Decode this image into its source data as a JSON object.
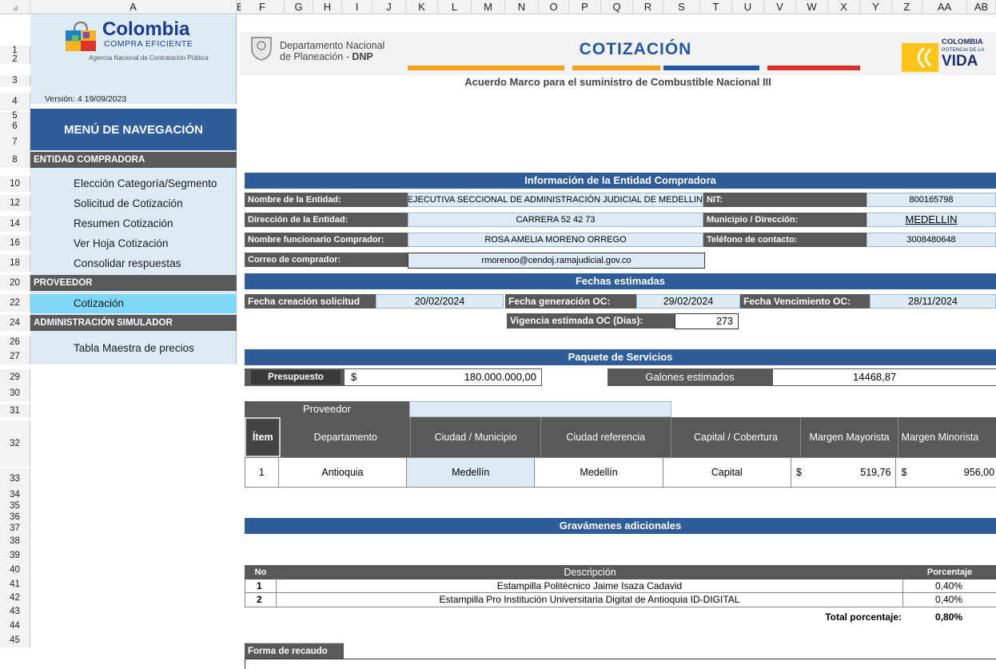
{
  "columns": [
    "A",
    "B",
    "F",
    "G",
    "H",
    "I",
    "J",
    "K",
    "L",
    "M",
    "N",
    "O",
    "P",
    "Q",
    "R",
    "S",
    "T",
    "U",
    "V",
    "W",
    "X",
    "Y",
    "Z",
    "AA",
    "AB"
  ],
  "rows": [
    "1",
    "2",
    "3",
    "4",
    "5",
    "6",
    "7",
    "8",
    "10",
    "12",
    "14",
    "16",
    "18",
    "20",
    "22",
    "24",
    "26",
    "27",
    "29",
    "30",
    "31",
    "32",
    "33",
    "34",
    "35",
    "36",
    "37",
    "38",
    "39",
    "40",
    "41",
    "42",
    "43",
    "44",
    "45"
  ],
  "sidebar": {
    "logo_title": "Colombia",
    "logo_subtitle": "COMPRA EFICIENTE",
    "agency": "Agencia Nacional de Contratación Pública",
    "version": "Versión: 4 19/09/2023",
    "menu_title": "MENÚ DE NAVEGACIÓN",
    "sections": [
      {
        "title": "ENTIDAD COMPRADORA",
        "items": [
          "Elección Categoría/Segmento",
          "Solicitud de Cotización",
          "Resumen Cotización",
          "Ver Hoja Cotización",
          "Consolidar respuestas"
        ]
      },
      {
        "title": "PROVEEDOR",
        "items": [
          "Cotización"
        ]
      },
      {
        "title": "ADMINISTRACIÓN SIMULADOR",
        "items": [
          "Tabla Maestra de precios"
        ]
      }
    ]
  },
  "header": {
    "dnp_line1": "Departamento Nacional",
    "dnp_line2a": "de Planeación - ",
    "dnp_line2b": "DNP",
    "title": "COTIZACIÓN",
    "subtitle": "Acuerdo Marco para el suministro de Combustible Nacional III",
    "right_logo_1": "COLOMBIA",
    "right_logo_2": "POTENCIA DE LA",
    "right_logo_3": "VIDA"
  },
  "entity": {
    "section_title": "Información de la Entidad Compradora",
    "name_label": "Nombre de la Entidad:",
    "name_value": "DIRECCIÓN EJECUTIVA SECCIONAL DE ADMINISTRACIÓN JUDICIAL DE MEDELLIN",
    "nit_label": "NIT:",
    "nit_value": "800165798",
    "address_label": "Dirección de la Entidad:",
    "address_value": "CARRERA 52 42 73",
    "city_label": "Municipio / Dirección:",
    "city_value": "MEDELLIN",
    "buyer_label": "Nombre funcionario Comprador:",
    "buyer_value": "ROSA AMELIA MORENO ORREGO",
    "phone_label": "Teléfono de contacto:",
    "phone_value": "3008480648",
    "email_label": "Correo de comprador:",
    "email_value": "rmorenoo@cendoj.ramajudicial.gov.co"
  },
  "dates": {
    "section_title": "Fechas estimadas",
    "created_label": "Fecha creación solicitud",
    "created_value": "20/02/2024",
    "oc_label": "Fecha generación OC:",
    "oc_value": "29/02/2024",
    "expiry_label": "Fecha Vencimiento OC:",
    "expiry_value": "28/11/2024",
    "validity_label": "Vigencia estimada OC (Dias):",
    "validity_value": "273"
  },
  "package": {
    "section_title": "Paquete de Servicios",
    "budget_label": "Presupuesto",
    "currency": "$",
    "budget_value": "180.000.000,00",
    "gallons_label": "Galones estimados",
    "gallons_value": "14468,87"
  },
  "provider": {
    "label": "Proveedor",
    "value": "",
    "headers": [
      "Ítem",
      "Departamento",
      "Ciudad / Municipio",
      "Ciudad referencia",
      "Capital / Cobertura",
      "Margen Mayorista",
      "Margen Minorista"
    ],
    "row": {
      "item": "1",
      "dept": "Antioquia",
      "city": "Medellín",
      "ref": "Medellín",
      "capital": "Capital",
      "cur1": "$",
      "mayorista": "519,76",
      "cur2": "$",
      "minorista": "956,00"
    }
  },
  "taxes": {
    "section_title": "Gravámenes adicionales",
    "headers": [
      "No",
      "Descripción",
      "Porcentaje"
    ],
    "rows": [
      {
        "no": "1",
        "desc": "Estampilla Politécnico Jaime Isaza Cadavid",
        "pct": "0,40%"
      },
      {
        "no": "2",
        "desc": "Estampilla Pro Institución Universitaria Digital de Antioquia ID-DIGITAL",
        "pct": "0,40%"
      }
    ],
    "total_label": "Total porcentaje:",
    "total_value": "0,80%"
  },
  "collection": {
    "label": "Forma de recaudo"
  },
  "colors": {
    "section_bar": "#2e5d9a",
    "dark_label": "#595959",
    "light_cell": "#ddebf7",
    "active_menu": "#7fd7f7"
  }
}
